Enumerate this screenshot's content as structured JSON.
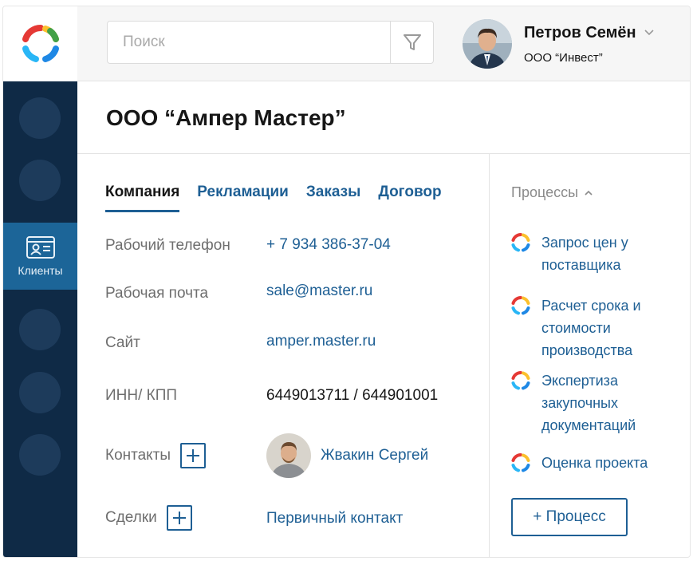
{
  "header": {
    "search_placeholder": "Поиск",
    "user_name": "Петров Семён",
    "user_org": "ООО “Инвест”"
  },
  "sidebar": {
    "active_label": "Клиенты"
  },
  "page": {
    "title": "ООО “Ампер Мастер”"
  },
  "tabs": [
    {
      "label": "Компания",
      "active": true
    },
    {
      "label": "Рекламации",
      "active": false
    },
    {
      "label": "Заказы",
      "active": false
    },
    {
      "label": "Договор",
      "active": false
    }
  ],
  "fields": {
    "phone_label": "Рабочий телефон",
    "phone_value": "+ 7 934 386-37-04",
    "email_label": "Рабочая почта",
    "email_value": "sale@master.ru",
    "site_label": "Сайт",
    "site_value": "amper.master.ru",
    "inn_label": "ИНН/ КПП",
    "inn_value": "6449013711 /  644901001",
    "contacts_label": "Контакты",
    "contact_name": "Жвакин Сергей",
    "deals_label": "Сделки",
    "deal_value": "Первичный контакт"
  },
  "processes": {
    "heading": "Процессы",
    "items": [
      {
        "label": "Запрос цен у поставщика"
      },
      {
        "label": "Расчет срока и стоимости производства"
      },
      {
        "label": "Экспертиза закупочных документаций"
      },
      {
        "label": "Оценка проекта"
      }
    ],
    "add_label": "+ Процесс"
  },
  "colors": {
    "accent": "#1e5f94",
    "sidebar": "#0f2a46",
    "sidebar_active": "#1c6598",
    "logo": [
      "#e53935",
      "#fbc02d",
      "#43a047",
      "#1e88e5"
    ]
  }
}
